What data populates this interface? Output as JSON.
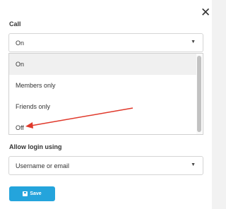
{
  "modal": {
    "close_glyph": "✕"
  },
  "call": {
    "label": "Call",
    "selected": "On",
    "options": [
      "On",
      "Members only",
      "Friends only",
      "Off"
    ]
  },
  "login": {
    "label": "Allow login using",
    "selected": "Username or email"
  },
  "save_button": {
    "label": "Save"
  },
  "colors": {
    "accent": "#24a4dc",
    "arrow": "#e0392b"
  }
}
